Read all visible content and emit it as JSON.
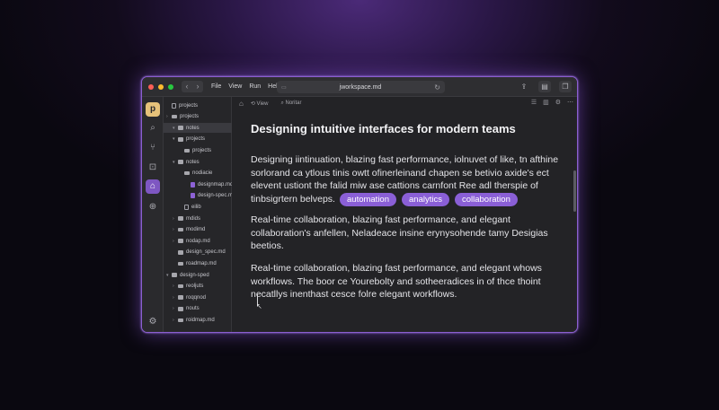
{
  "window": {
    "nav_back": "‹",
    "nav_forward": "›",
    "menu": [
      "File",
      "View",
      "Run",
      "Help"
    ],
    "url": "jworkspace.md"
  },
  "rail_icons": [
    "logo-icon",
    "search-icon",
    "git-icon",
    "extensions-icon",
    "home-icon",
    "globe-icon",
    "settings-icon"
  ],
  "sidebar": {
    "items": [
      {
        "label": "projects",
        "level": 0,
        "kind": "file"
      },
      {
        "label": "projects",
        "level": 0,
        "kind": "folder",
        "chev": "›"
      },
      {
        "label": "notes",
        "level": 1,
        "kind": "folder",
        "chev": "▾",
        "selected": true
      },
      {
        "label": "projects",
        "level": 1,
        "kind": "folder",
        "chev": "▾"
      },
      {
        "label": "projects",
        "level": 2,
        "kind": "folder",
        "chev": ""
      },
      {
        "label": "notes",
        "level": 1,
        "kind": "folder",
        "chev": "▾"
      },
      {
        "label": "nodiacie",
        "level": 2,
        "kind": "folder",
        "chev": ""
      },
      {
        "label": "designmap.md",
        "level": 3,
        "kind": "file-purple"
      },
      {
        "label": "design-spec.md",
        "level": 3,
        "kind": "file-purple"
      },
      {
        "label": "eilib",
        "level": 2,
        "kind": "file"
      },
      {
        "label": "mdids",
        "level": 1,
        "kind": "folder",
        "chev": "›"
      },
      {
        "label": "modimd",
        "level": 1,
        "kind": "folder",
        "chev": "›"
      },
      {
        "label": "nodap.md",
        "level": 1,
        "kind": "folder",
        "chev": "›"
      },
      {
        "label": "design_spec.md",
        "level": 1,
        "kind": "folder",
        "chev": ""
      },
      {
        "label": "roadmap.md",
        "level": 1,
        "kind": "folder",
        "chev": ""
      },
      {
        "label": "design-sped",
        "level": 0,
        "kind": "folder",
        "chev": "▾"
      },
      {
        "label": "reoljuts",
        "level": 1,
        "kind": "folder",
        "chev": "›"
      },
      {
        "label": "roqqnod",
        "level": 1,
        "kind": "folder",
        "chev": "›"
      },
      {
        "label": "nouts",
        "level": 1,
        "kind": "folder",
        "chev": "›"
      },
      {
        "label": "roidmap.md",
        "level": 1,
        "kind": "folder",
        "chev": "›"
      }
    ]
  },
  "editor": {
    "breadcrumb_view": "View",
    "breadcrumb_file": "Noritar",
    "title": "Designing intuitive interfaces for modern teams",
    "paragraph1": [
      "Designing iintinuation, blazing fast performance, iolnuvet of like, tn afthine",
      "sorlorand ca ytlous tinis owtt ofinerleinand chapen se betivio axide's ect",
      "elevent ustiont the falid miw ase cattions carnfont Ree adl therspie of",
      "tinbsigrtern belveps."
    ],
    "tags": [
      "automation",
      "analytics",
      "collaboration"
    ],
    "paragraph2": [
      "Real-time collaboration, blazing fast performance, and elegant",
      "collaboration's anfellen, Neladeace insine erynysohende tamy Desigias",
      "beetios."
    ],
    "paragraph3": [
      "Real-time collaboration, blazing fast performance, and elegant whows",
      "workflows. The boor ce Yourebolty and sotheeradices in of thce thoint",
      "necatllys inenthast cesce folre elegant workflows."
    ]
  },
  "colors": {
    "accent": "#8a5fd6",
    "window_border": "#8b5ed0",
    "background": "#232326"
  }
}
